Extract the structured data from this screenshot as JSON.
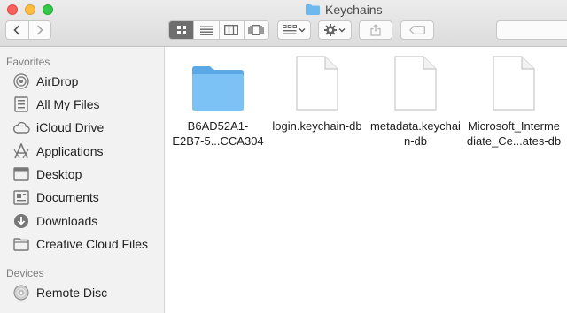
{
  "window": {
    "title": "Keychains"
  },
  "sidebar": {
    "favorites_title": "Favorites",
    "favorites": [
      {
        "label": "AirDrop",
        "icon": "airdrop-icon"
      },
      {
        "label": "All My Files",
        "icon": "all-files-icon"
      },
      {
        "label": "iCloud Drive",
        "icon": "cloud-icon"
      },
      {
        "label": "Applications",
        "icon": "applications-icon"
      },
      {
        "label": "Desktop",
        "icon": "desktop-icon"
      },
      {
        "label": "Documents",
        "icon": "documents-icon"
      },
      {
        "label": "Downloads",
        "icon": "downloads-icon"
      },
      {
        "label": "Creative Cloud Files",
        "icon": "folder-icon"
      }
    ],
    "devices_title": "Devices",
    "devices": [
      {
        "label": "Remote Disc",
        "icon": "disc-icon"
      }
    ]
  },
  "files": [
    {
      "line1": "B6AD52A1-",
      "line2": "E2B7-5...CCA304",
      "type": "folder"
    },
    {
      "line1": "login.keychain-db",
      "line2": "",
      "type": "document"
    },
    {
      "line1": "metadata.keychai",
      "line2": "n-db",
      "type": "document"
    },
    {
      "line1": "Microsoft_Interme",
      "line2": "diate_Ce...ates-db",
      "type": "document"
    }
  ],
  "colors": {
    "folder": "#6fb8ef",
    "sidebar": "#f2f2f2",
    "active_view": "#6e6e6e"
  }
}
